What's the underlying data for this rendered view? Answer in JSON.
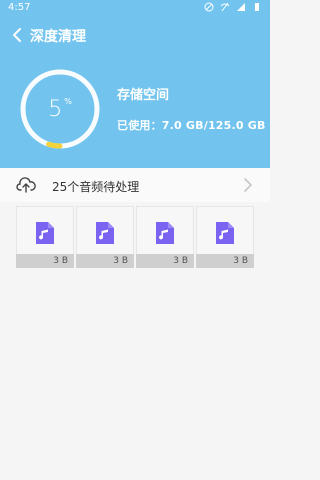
{
  "status_bar": {
    "time": "4:57"
  },
  "header": {
    "title": "深度清理",
    "gauge": {
      "percent": "5",
      "percent_symbol": "%",
      "fraction": 0.05
    },
    "storage": {
      "title": "存储空间",
      "used": "已使用：7.0 GB/125.0 GB"
    }
  },
  "audio_section": {
    "label": "25个音频待处理",
    "files": [
      {
        "size": "3 B",
        "icon": "music-file-icon"
      },
      {
        "size": "3 B",
        "icon": "music-file-icon"
      },
      {
        "size": "3 B",
        "icon": "music-file-icon"
      },
      {
        "size": "3 B",
        "icon": "music-file-icon"
      }
    ]
  },
  "colors": {
    "header": "#72c4ee",
    "accent": "#f3d23a",
    "file_icon": "#7b63f2"
  }
}
